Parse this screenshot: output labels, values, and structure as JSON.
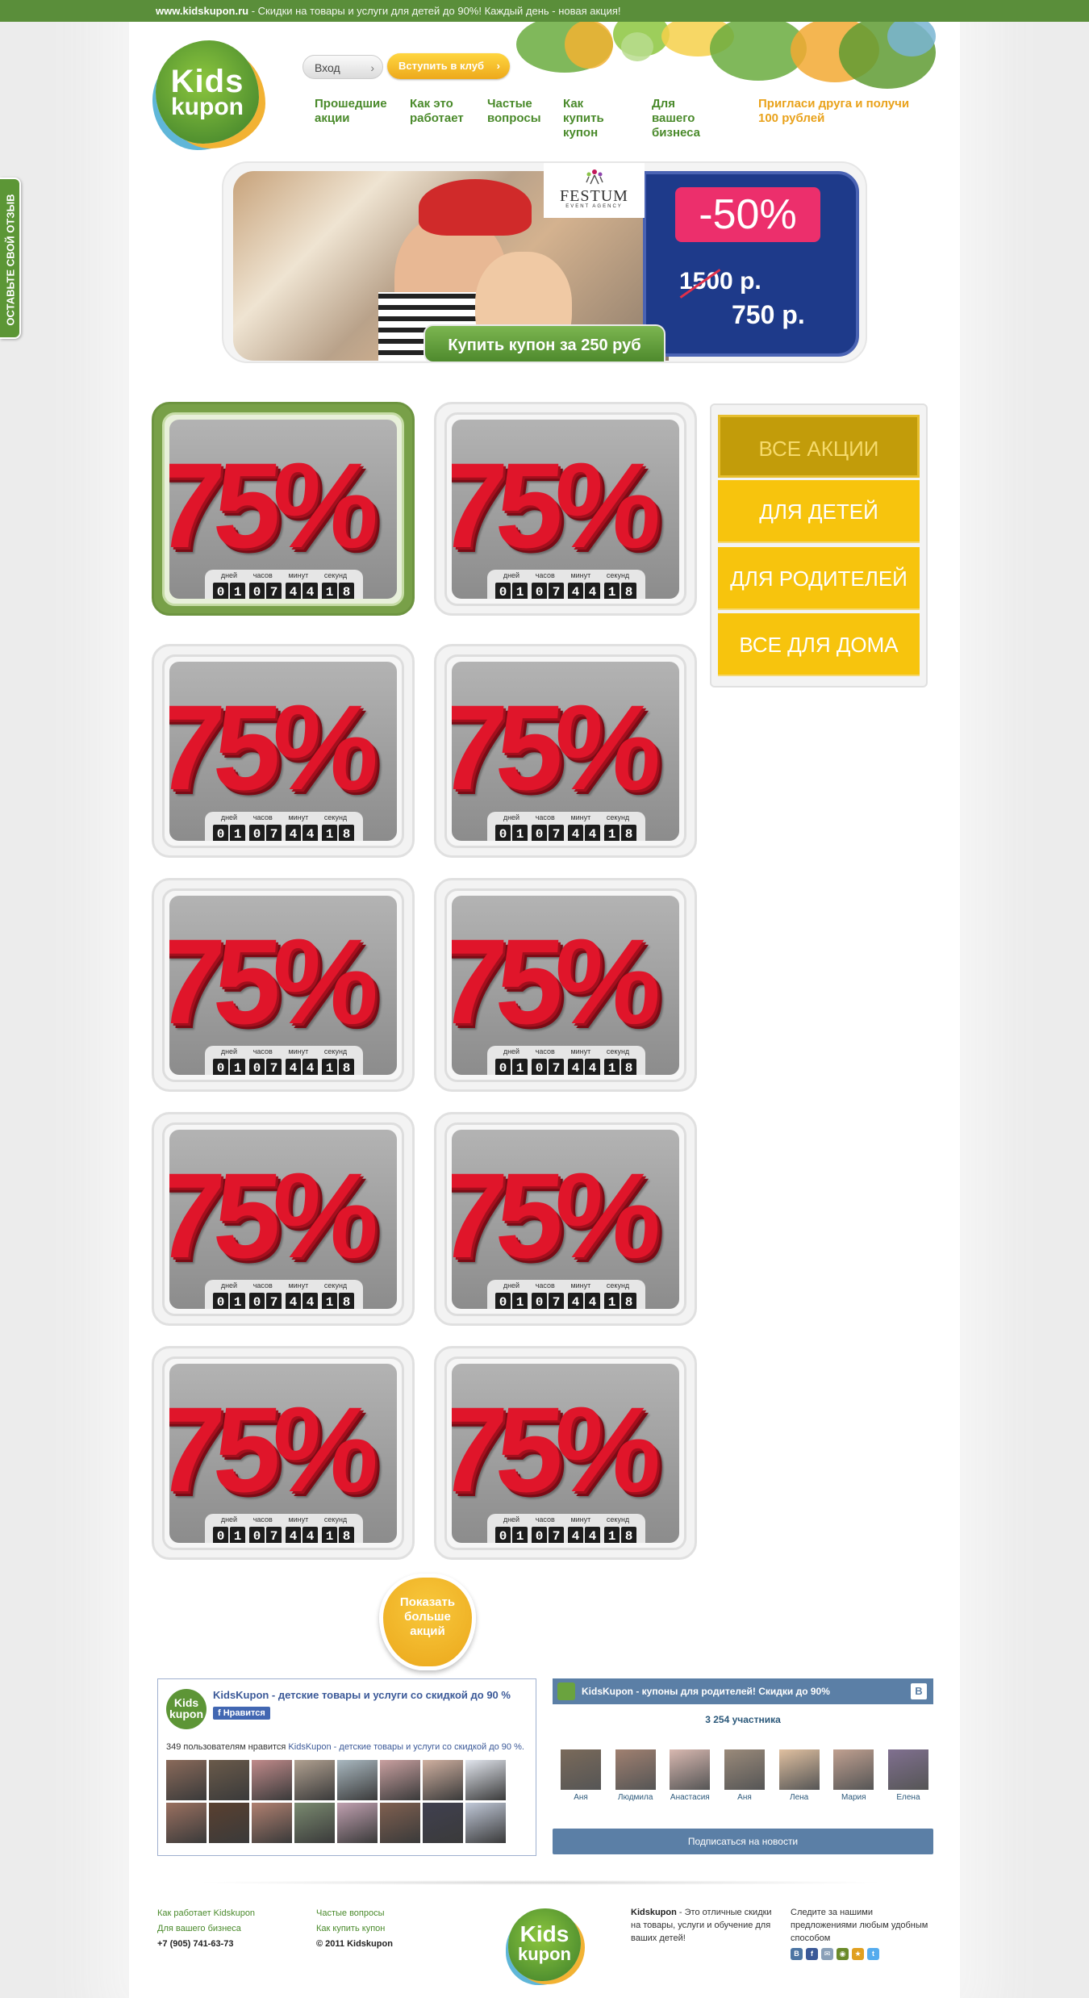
{
  "topbar": {
    "site": "www.kidskupon.ru",
    "tagline": " - Скидки на товары и услуги для детей до 90%! Каждый день - новая акция!"
  },
  "header": {
    "logo_line1": "Kids",
    "logo_line2": "kupon",
    "login_label": "Вход",
    "join_label": "Вступить в клуб",
    "nav": [
      {
        "label": "Прошедшие\nакции"
      },
      {
        "label": "Как это\nработает"
      },
      {
        "label": "Частые\nвопросы"
      },
      {
        "label": "Как купить\nкупон"
      },
      {
        "label": "Для вашего\nбизнеса"
      }
    ],
    "invite": "Пригласи друга и получи\n100 рублей"
  },
  "banner": {
    "partner": "FESTUM",
    "partner_sub": "EVENT AGENCY",
    "discount": "-50%",
    "old_price": "1500 р.",
    "new_price": "750 р.",
    "buy_label": "Купить купон за 250 руб"
  },
  "deal_template": {
    "percent": "75%",
    "timer_labels": [
      "дней",
      "часов",
      "минут",
      "секунд"
    ],
    "timer_digits": [
      "0",
      "1",
      "0",
      "7",
      "4",
      "4",
      "1",
      "8"
    ]
  },
  "categories": [
    {
      "label": "ВСЕ АКЦИИ",
      "selected": true
    },
    {
      "label": "ДЛЯ ДЕТЕЙ",
      "selected": false
    },
    {
      "label": "ДЛЯ РОДИТЕЛЕЙ",
      "selected": false
    },
    {
      "label": "ВСЕ ДЛЯ ДОМА",
      "selected": false
    }
  ],
  "show_more": "Показать\nбольше\nакций",
  "side_tab": "ОСТАВЬТЕ СВОЙ ОТЗЫВ",
  "fb_widget": {
    "logo": "Kids\nkupon",
    "title": "KidsKupon - детские товары и услуги со скидкой до 90 %",
    "like": "Нравится",
    "count_prefix": "349 пользователям нравится ",
    "count_link": "KidsKupon - детские товары и услуги со скидкой до 90 %."
  },
  "vk_widget": {
    "title": "KidsKupon - купоны для родителей! Скидки до 90%",
    "badge": "B",
    "members": "3 254 участника",
    "people": [
      "Аня",
      "Людмила",
      "Анастасия",
      "Аня",
      "Лена",
      "Мария",
      "Елена"
    ],
    "subscribe": "Подписаться на новости"
  },
  "footer": {
    "col1": [
      "Как работает Kidskupon",
      "Для вашего бизнеса"
    ],
    "phone": "+7 (905) 741-63-73",
    "col2": [
      "Частые вопросы",
      "Как купить купон"
    ],
    "copyright": "© 2011 Kidskupon",
    "about_brand": "Kidskupon",
    "about_text": " - Это отличные скидки на товары, услуги и обучение для ваших детей!",
    "follow": "Следите за нашими предложениями любым удобным способом",
    "socials": [
      "B",
      "f",
      "✉",
      "◉",
      "★",
      "t"
    ]
  },
  "colors": {
    "green": "#5a8e3a",
    "yellow": "#f7c40d",
    "red": "#e0152a",
    "pink": "#ec2f6c",
    "navy": "#1e3a8a"
  }
}
